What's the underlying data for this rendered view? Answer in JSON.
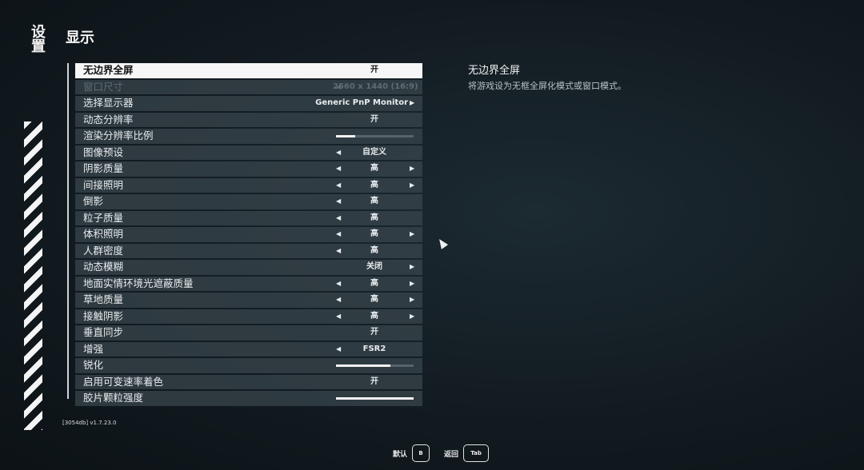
{
  "sidebar": {
    "title": "设置"
  },
  "page": {
    "title": "显示"
  },
  "settings": [
    {
      "label": "无边界全屏",
      "kind": "value",
      "value": "开",
      "active": true
    },
    {
      "label": "窗口尺寸",
      "kind": "value",
      "value": "2560 x 1440 (16:9)",
      "left_arrow": true,
      "disabled": true
    },
    {
      "label": "选择显示器",
      "kind": "value",
      "value": "Generic PnP Monitor",
      "right_arrow": true,
      "align": "right"
    },
    {
      "label": "动态分辨率",
      "kind": "value",
      "value": "开"
    },
    {
      "label": "渲染分辨率比例",
      "kind": "slider",
      "level": 0.25
    },
    {
      "label": "图像预设",
      "kind": "value",
      "value": "自定义",
      "left_arrow": true
    },
    {
      "label": "阴影质量",
      "kind": "value",
      "value": "高",
      "left_arrow": true,
      "right_arrow": true
    },
    {
      "label": "间接照明",
      "kind": "value",
      "value": "高",
      "left_arrow": true,
      "right_arrow": true
    },
    {
      "label": "倒影",
      "kind": "value",
      "value": "高",
      "left_arrow": true
    },
    {
      "label": "粒子质量",
      "kind": "value",
      "value": "高",
      "left_arrow": true
    },
    {
      "label": "体积照明",
      "kind": "value",
      "value": "高",
      "left_arrow": true,
      "right_arrow": true
    },
    {
      "label": "人群密度",
      "kind": "value",
      "value": "高",
      "left_arrow": true
    },
    {
      "label": "动态模糊",
      "kind": "value",
      "value": "关闭",
      "right_arrow": true
    },
    {
      "label": "地面实情环境光遮蔽质量",
      "kind": "value",
      "value": "高",
      "left_arrow": true,
      "right_arrow": true
    },
    {
      "label": "草地质量",
      "kind": "value",
      "value": "高",
      "left_arrow": true,
      "right_arrow": true
    },
    {
      "label": "接触阴影",
      "kind": "value",
      "value": "高",
      "left_arrow": true,
      "right_arrow": true
    },
    {
      "label": "垂直同步",
      "kind": "value",
      "value": "开"
    },
    {
      "label": "增强",
      "kind": "value",
      "value": "FSR2",
      "left_arrow": true
    },
    {
      "label": "锐化",
      "kind": "slider",
      "level": 0.7
    },
    {
      "label": "启用可变速率着色",
      "kind": "value",
      "value": "开"
    },
    {
      "label": "胶片颗粒强度",
      "kind": "slider",
      "level": 1.0
    }
  ],
  "info": {
    "title": "无边界全屏",
    "description": "将游戏设为无框全屏化模式或窗口模式。"
  },
  "version": "[3054db] v1.7.23.0",
  "footer": {
    "default_label": "默认",
    "default_key": "B",
    "back_label": "返回",
    "back_key": "Tab"
  },
  "icons": {
    "left": "◀",
    "right": "▶"
  }
}
